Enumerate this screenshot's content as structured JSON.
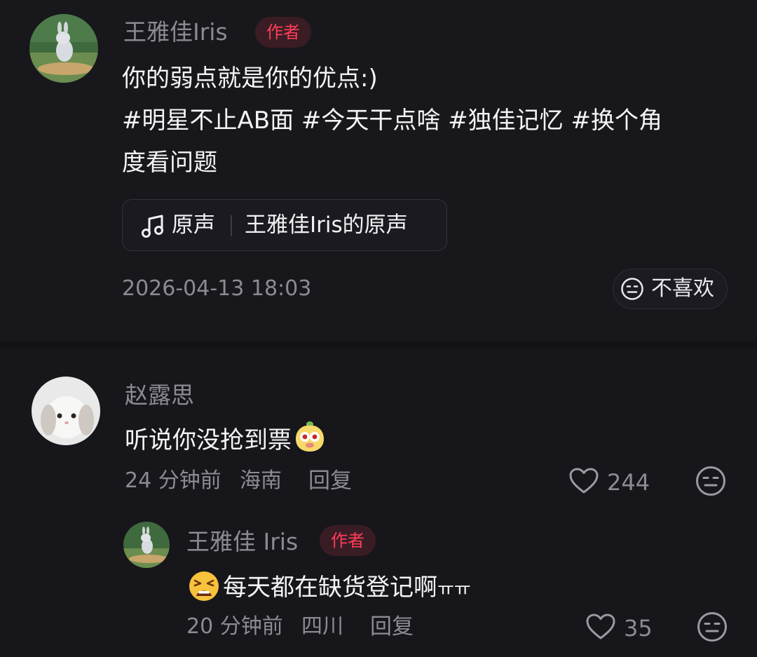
{
  "post": {
    "author": "王雅佳Iris",
    "author_badge": "作者",
    "caption_line1": "你的弱点就是你的优点:)",
    "caption_line2": "#明星不止AB面 #今天干点啥 #独佳记忆  #换个角",
    "caption_line3": "度看问题",
    "music": {
      "kind": "原声",
      "title": "王雅佳Iris的原声"
    },
    "date": "2026-04-13 18:03",
    "dislike_label": "不喜欢"
  },
  "comments": [
    {
      "author": "赵露思",
      "text": "听说你没抢到票",
      "emoji": "peeking-face-emoji",
      "time": "24 分钟前",
      "location": "海南",
      "reply_label": "回复",
      "likes": "244"
    }
  ],
  "reply": {
    "author": "王雅佳 Iris",
    "author_badge": "作者",
    "emoji": "tired-face-emoji",
    "text": "每天都在缺货登记啊",
    "suffix": "ㅠㅠ",
    "time": "20 分钟前",
    "location": "四川",
    "reply_label": "回复",
    "likes": "35"
  },
  "icons": {
    "music": "music-note-icon",
    "dislike": "neutral-face-icon",
    "like": "heart-outline-icon",
    "comment_dislike": "neutral-face-icon"
  },
  "colors": {
    "background": "#17161b",
    "badge_text": "#ff3d5a",
    "badge_bg": "#3a1d24",
    "muted_text": "#8c8b91"
  }
}
